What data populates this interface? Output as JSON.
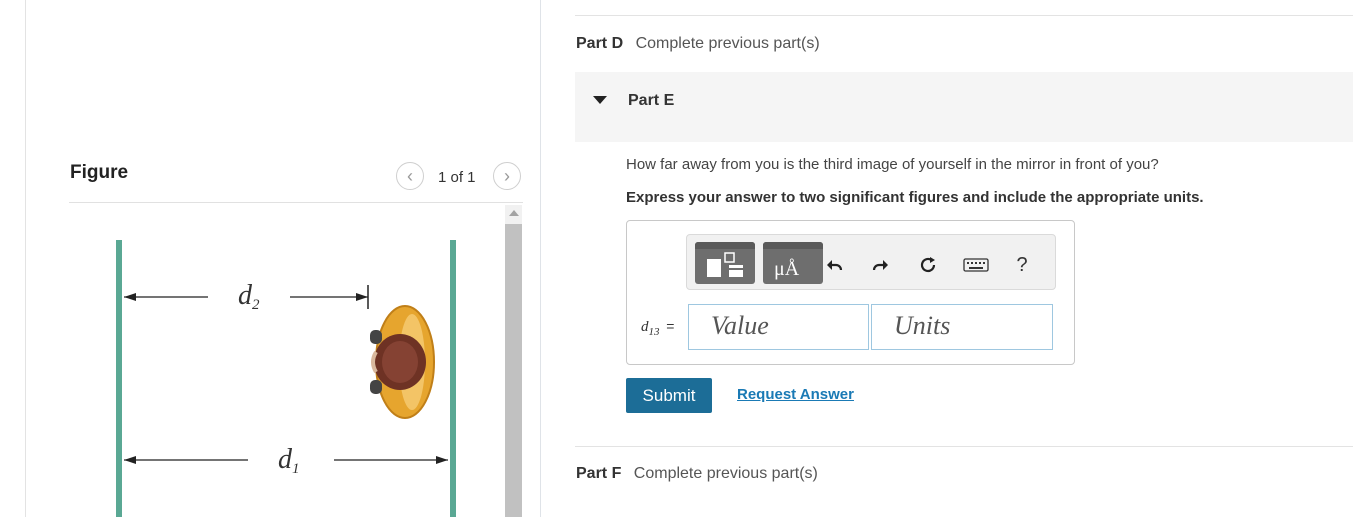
{
  "figure_panel": {
    "title": "Figure",
    "counter": "1 of 1",
    "prev_icon": "chevron-left-icon",
    "next_icon": "chevron-right-icon",
    "diagram": {
      "label_d2_base": "d",
      "label_d2_sub": "2",
      "label_d1_base": "d",
      "label_d1_sub": "1",
      "mirror_color": "#5aa894"
    }
  },
  "parts": {
    "part_d": {
      "title": "Part D",
      "status": "Complete previous part(s)"
    },
    "part_e": {
      "title": "Part E",
      "question": "How far away from you is the third image of yourself in the mirror in front of you?",
      "instruction": "Express your answer to two significant figures and include the appropriate units.",
      "toolbar": {
        "templates_icon": "templates-icon",
        "units_label": "μÅ",
        "undo_icon": "undo-icon",
        "redo_icon": "redo-icon",
        "reset_icon": "reset-icon",
        "keyboard_icon": "keyboard-icon",
        "help_label": "?"
      },
      "variable_base": "d",
      "variable_sub": "13",
      "equals": "=",
      "value_placeholder": "Value",
      "units_placeholder": "Units",
      "submit_label": "Submit",
      "request_label": "Request Answer"
    },
    "part_f": {
      "title": "Part F",
      "status": "Complete previous part(s)"
    }
  },
  "colors": {
    "submit_bg": "#1c6d97",
    "link": "#1a7ab5",
    "input_border": "#9ec7e0"
  }
}
